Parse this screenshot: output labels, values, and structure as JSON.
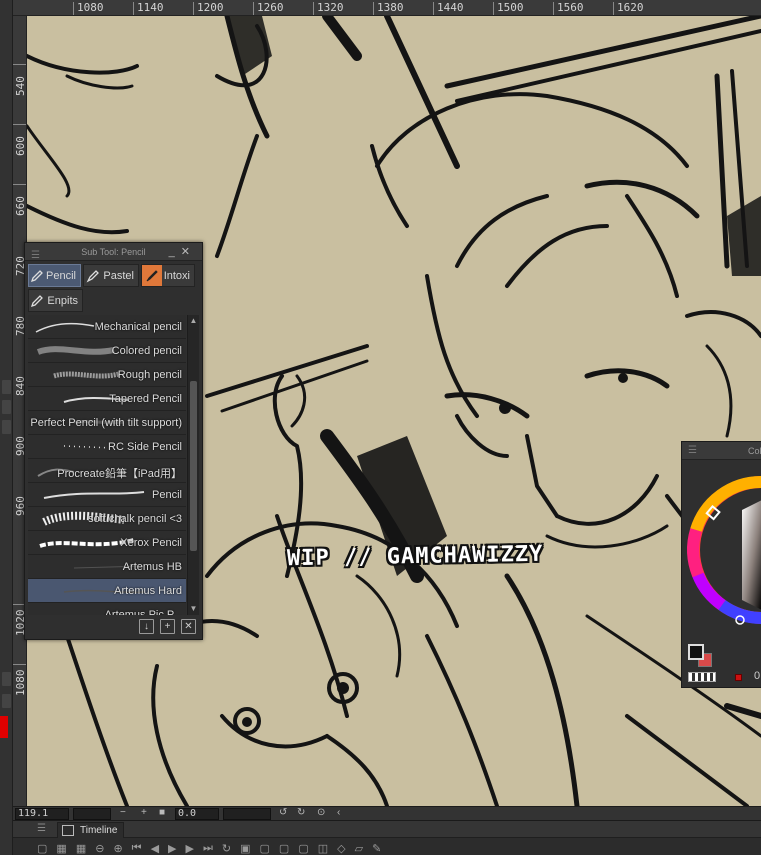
{
  "ruler_top": {
    "labels": [
      "1080",
      "1140",
      "1200",
      "1260",
      "1320",
      "1380",
      "1440",
      "1500",
      "1560",
      "1620"
    ]
  },
  "ruler_left": {
    "labels": [
      "540",
      "600",
      "660",
      "720",
      "780",
      "840",
      "900",
      "960",
      "1020",
      "1080"
    ]
  },
  "canvas": {
    "background": "#c9bfa0",
    "watermark": "WIP // GAMCHAWIZZY"
  },
  "sub_tool": {
    "title": "Sub Tool: Pencil",
    "tabs": [
      {
        "label": "Pencil",
        "icon": "pencil-icon",
        "active": true
      },
      {
        "label": "Pastel",
        "icon": "pastel-icon",
        "active": false
      },
      {
        "label": "Intoxi",
        "icon": "brush-icon",
        "active": false
      },
      {
        "label": "Enpits",
        "icon": "pencil-icon",
        "active": false
      }
    ],
    "brushes": [
      "Mechanical pencil",
      "Colored pencil",
      "Rough pencil",
      "Tapered Pencil",
      "Perfect Pencil (with tilt support)",
      "RC Side Pencil",
      "Procreate鉛筆【iPad用】",
      "Pencil",
      "soft chalk pencil <3",
      "Xerox Pencil",
      "Artemus HB",
      "Artemus Hard",
      "Artemus Pic P..."
    ],
    "selected_index": 11
  },
  "color_panel": {
    "title": "Col",
    "main_color": "#111111",
    "sub_color": "#d84a4a",
    "value": "0"
  },
  "status": {
    "zoom": "119.1",
    "angle": "0.0"
  },
  "timeline": {
    "tab_label": "Timeline"
  }
}
